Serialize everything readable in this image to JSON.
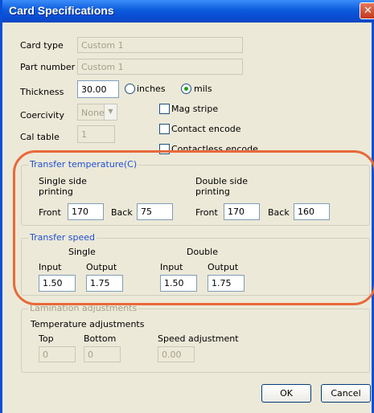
{
  "window": {
    "title": "Card Specifications",
    "close_glyph": "✕"
  },
  "card_type": {
    "label": "Card type",
    "value": "Custom 1"
  },
  "part_number": {
    "label": "Part number",
    "value": "Custom 1"
  },
  "thickness": {
    "label": "Thickness",
    "value": "30.00",
    "unit_inches": "inches",
    "unit_mils": "mils",
    "selected_unit": "mils"
  },
  "coercivity": {
    "label": "Coercivity",
    "value": "None"
  },
  "cal_table": {
    "label": "Cal table",
    "value": "1"
  },
  "options": {
    "mag_stripe": "Mag stripe",
    "contact_encode": "Contact encode",
    "contactless_encode": "Contactless encode"
  },
  "transfer_temperature": {
    "title": "Transfer temperature(C)",
    "single_label_1": "Single side",
    "single_label_2": "printing",
    "double_label_1": "Double side",
    "double_label_2": "printing",
    "front_label": "Front",
    "back_label": "Back",
    "single_front": "170",
    "single_back": "75",
    "double_front": "170",
    "double_back": "160"
  },
  "transfer_speed": {
    "title": "Transfer speed",
    "single_label": "Single",
    "double_label": "Double",
    "input_label": "Input",
    "output_label": "Output",
    "single_input": "1.50",
    "single_output": "1.75",
    "double_input": "1.50",
    "double_output": "1.75"
  },
  "lamination": {
    "title": "Lamination adjustments",
    "temp_adjustments": "Temperature adjustments",
    "top_label": "Top",
    "bottom_label": "Bottom",
    "speed_label": "Speed adjustment",
    "top_value": "0",
    "bottom_value": "0",
    "speed_value": "0.00"
  },
  "buttons": {
    "ok": "OK",
    "cancel": "Cancel"
  },
  "colors": {
    "accent": "#0a4fd6",
    "highlight": "#e8693a",
    "group_title": "#1f4fd1"
  }
}
